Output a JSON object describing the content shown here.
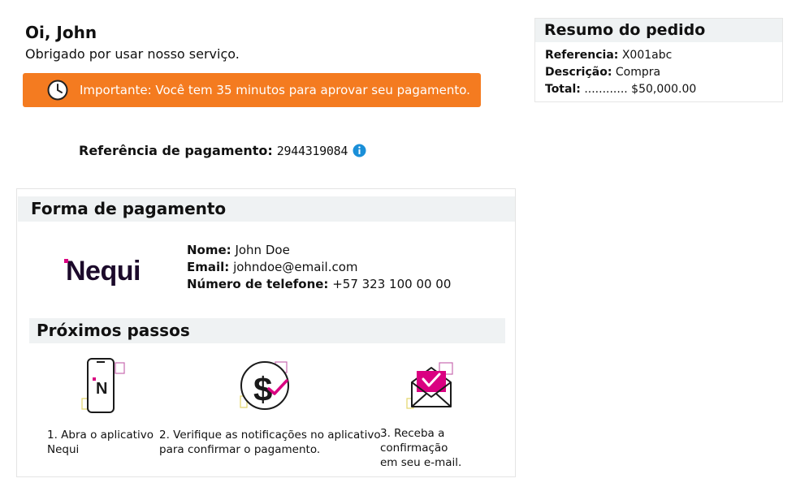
{
  "greeting": {
    "title": "Oi, John",
    "subtitle": "Obrigado por usar nosso serviço."
  },
  "alert": {
    "text": "Importante: Você tem 35 minutos para aprovar seu pagamento.",
    "icon": "clock-icon",
    "color": "#f47b20"
  },
  "payment_reference": {
    "label": "Referência de pagamento:",
    "value": "2944319084",
    "icon": "info-icon"
  },
  "order_summary": {
    "title": "Resumo do pedido",
    "reference_label": "Referencia:",
    "reference_value": "X001abc",
    "description_label": "Descrição:",
    "description_value": "Compra",
    "total_label": "Total:",
    "total_value": "............ $50,000.00"
  },
  "payment_method": {
    "title": "Forma de pagamento",
    "logo_text": "Nequi",
    "name_label": "Nome:",
    "name_value": "John Doe",
    "email_label": "Email:",
    "email_value": "johndoe@email.com",
    "phone_label": "Número de telefone:",
    "phone_value": "+57 323 100 00 00"
  },
  "next_steps": {
    "title": "Próximos passos",
    "steps": [
      {
        "icon": "phone-app-icon",
        "line1": "1. Abra o aplicativo",
        "line2": "Nequi"
      },
      {
        "icon": "dollar-check-icon",
        "line1": "2. Verifique as notificações no aplicativo",
        "line2": "para confirmar o pagamento."
      },
      {
        "icon": "envelope-check-icon",
        "line1": "3. Receba a confirmação",
        "line2": "em seu e-mail."
      }
    ]
  },
  "colors": {
    "accent_orange": "#f47b20",
    "nequi_magenta": "#da0081",
    "section_bg": "#eff2f3",
    "info_blue": "#1a8fd8"
  }
}
